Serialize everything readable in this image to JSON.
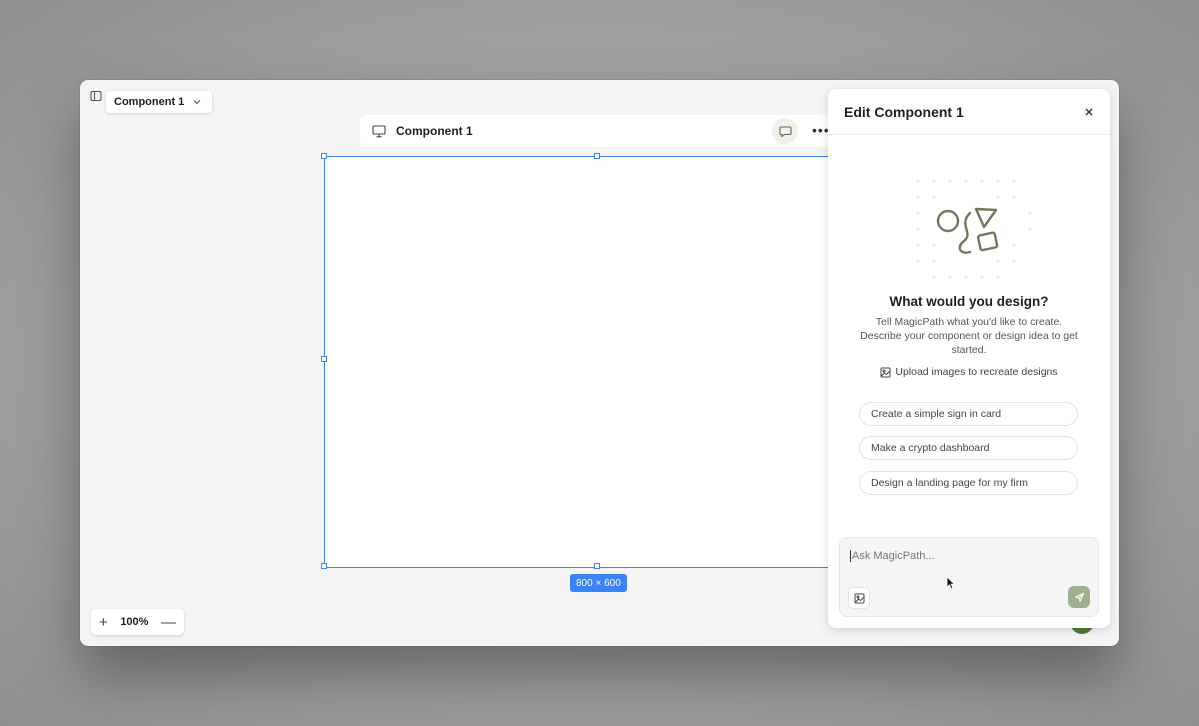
{
  "toolbar": {
    "component_name": "Component 1"
  },
  "frame": {
    "title": "Component 1",
    "size_label": "800 × 600"
  },
  "zoom": {
    "level": "100%",
    "plus": "+",
    "minus": "—"
  },
  "panel": {
    "title": "Edit Component 1",
    "heading": "What would you design?",
    "description": "Tell MagicPath what you'd like to create. Describe your component or design idea to get started.",
    "upload_label": "Upload images to recreate designs",
    "suggestions": [
      "Create a simple sign in card",
      "Make a crypto dashboard",
      "Design a landing page for my firm"
    ],
    "input_placeholder": "Ask MagicPath..."
  },
  "colors": {
    "selection": "#3b82f6",
    "accent_green": "#5f6b4f",
    "send_button": "#9fb08f"
  }
}
